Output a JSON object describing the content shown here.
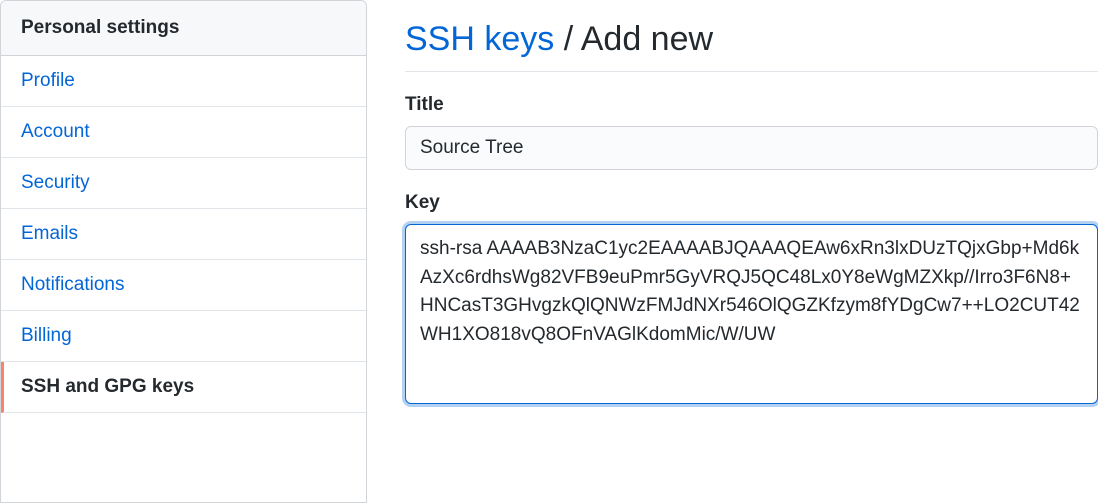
{
  "sidebar": {
    "header": "Personal settings",
    "items": [
      {
        "label": "Profile"
      },
      {
        "label": "Account"
      },
      {
        "label": "Security"
      },
      {
        "label": "Emails"
      },
      {
        "label": "Notifications"
      },
      {
        "label": "Billing"
      },
      {
        "label": "SSH and GPG keys"
      }
    ]
  },
  "page": {
    "title_link": "SSH keys",
    "title_sep": " / ",
    "title_current": "Add new"
  },
  "form": {
    "title_label": "Title",
    "title_value": "Source Tree",
    "key_label": "Key",
    "key_value": "ssh-rsa AAAAB3NzaC1yc2EAAAABJQAAAQEAw6xRn3lxDUzTQjxGbp+Md6kAzXc6rdhsWg82VFB9euPmr5GyVRQJ5QC48Lx0Y8eWgMZXkp//Irro3F6N8+HNCasT3GHvgzkQlQNWzFMJdNXr546OlQGZKfzym8fYDgCw7++LO2CUT42WH1XO818vQ8OFnVAGlKdomMic/W/UW"
  }
}
